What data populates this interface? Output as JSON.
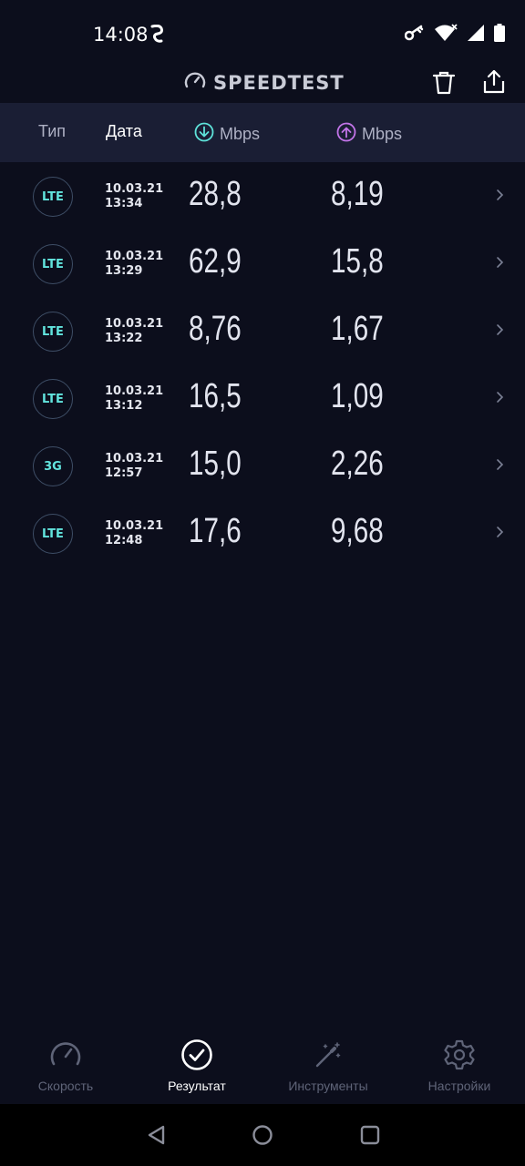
{
  "status": {
    "time": "14:08"
  },
  "header": {
    "app_name": "SPEEDTEST"
  },
  "columns": {
    "type": "Тип",
    "date": "Дата",
    "download": "Mbps",
    "upload": "Mbps"
  },
  "results": [
    {
      "type": "LTE",
      "date": "10.03.21",
      "time": "13:34",
      "download": "28,8",
      "upload": "8,19"
    },
    {
      "type": "LTE",
      "date": "10.03.21",
      "time": "13:29",
      "download": "62,9",
      "upload": "15,8"
    },
    {
      "type": "LTE",
      "date": "10.03.21",
      "time": "13:22",
      "download": "8,76",
      "upload": "1,67"
    },
    {
      "type": "LTE",
      "date": "10.03.21",
      "time": "13:12",
      "download": "16,5",
      "upload": "1,09"
    },
    {
      "type": "3G",
      "date": "10.03.21",
      "time": "12:57",
      "download": "15,0",
      "upload": "2,26"
    },
    {
      "type": "LTE",
      "date": "10.03.21",
      "time": "12:48",
      "download": "17,6",
      "upload": "9,68"
    }
  ],
  "nav": {
    "speed": "Скорость",
    "results": "Результат",
    "tools": "Инструменты",
    "settings": "Настройки"
  },
  "colors": {
    "background": "#0c0e1c",
    "header_band": "#1a1e34",
    "download_accent": "#5ee2d9",
    "upload_accent": "#c274e8",
    "badge_text": "#62e4de"
  },
  "icons": {
    "status": [
      "vpn-icon",
      "key-icon",
      "wifi-icon",
      "signal-icon",
      "battery-icon"
    ],
    "header": [
      "gauge-icon",
      "trash-icon",
      "share-icon"
    ],
    "nav": [
      "speedometer-icon",
      "check-circle-icon",
      "magic-wand-icon",
      "gear-icon"
    ],
    "system": [
      "back-icon",
      "home-icon",
      "recents-icon"
    ]
  }
}
